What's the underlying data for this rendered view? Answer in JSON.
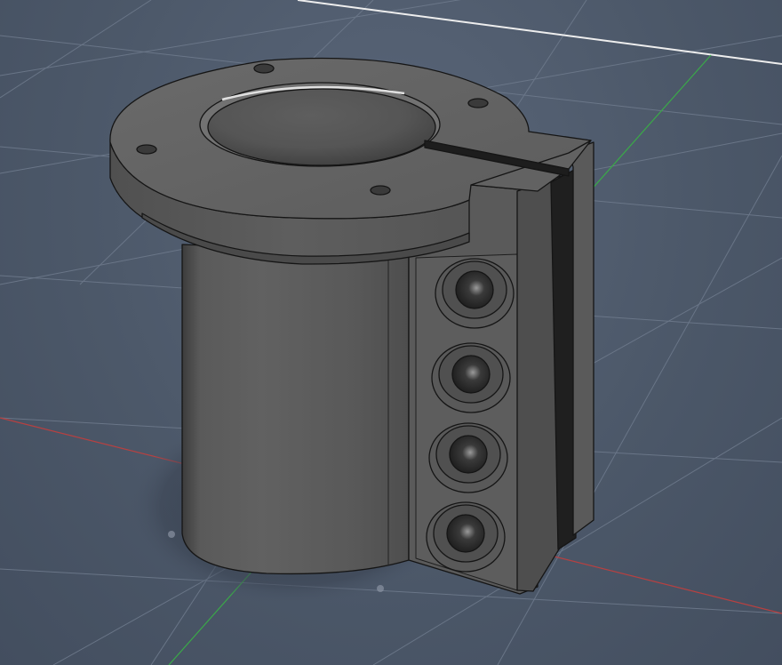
{
  "viewport": {
    "background_color": "#4d5a6c",
    "grid_line_color": "#6e7a8c",
    "axis_x_color": "#b83a3a",
    "axis_y_color": "#3aa84a",
    "horizon_color": "#f0f0f0",
    "show_grid": true
  },
  "model": {
    "part": "flanged-cylindrical-bushing-with-split-clamp",
    "body_color": "#5b5b5b",
    "edge_color": "#1a1a1a",
    "flange_mount_hole_count": 4,
    "clamp_bolt_hole_count": 4,
    "has_split_slot": true
  }
}
